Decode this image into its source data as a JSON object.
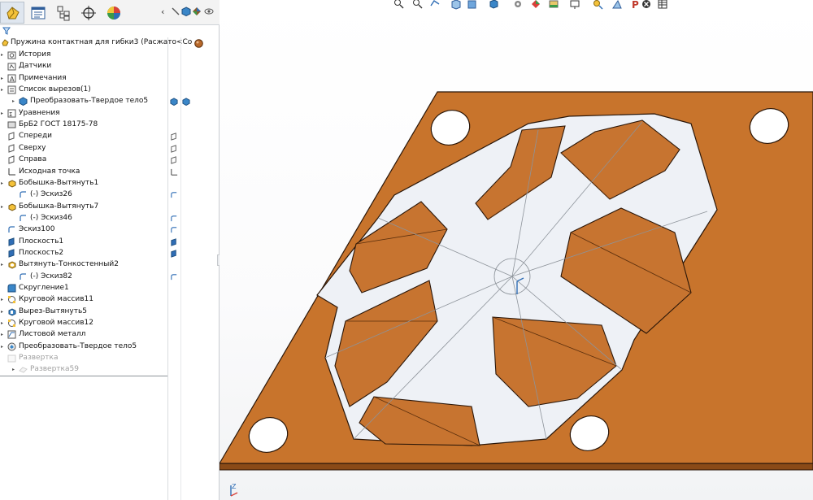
{
  "feature_tree": {
    "root_label": "Пружина контактная для гибки3  (Расжато<Сос",
    "items": [
      {
        "label": "История",
        "icon": "history-folder-icon"
      },
      {
        "label": "Датчики",
        "icon": "sensors-icon"
      },
      {
        "label": "Примечания",
        "icon": "annotations-icon"
      },
      {
        "label": "Список вырезов(1)",
        "icon": "cut-list-icon"
      },
      {
        "label": "Преобразовать-Твердое тело5",
        "icon": "solid-body-icon"
      },
      {
        "label": "Уравнения",
        "icon": "equations-icon"
      },
      {
        "label": "БрБ2 ГОСТ 18175-78",
        "icon": "material-icon"
      },
      {
        "label": "Спереди",
        "icon": "plane-icon"
      },
      {
        "label": "Сверху",
        "icon": "plane-icon"
      },
      {
        "label": "Справа",
        "icon": "plane-icon"
      },
      {
        "label": "Исходная точка",
        "icon": "origin-icon"
      },
      {
        "label": "Бобышка-Вытянуть1",
        "icon": "extrude-boss-icon"
      },
      {
        "label": "(-) Эскиз26",
        "icon": "sketch-icon"
      },
      {
        "label": "Бобышка-Вытянуть7",
        "icon": "extrude-boss-icon"
      },
      {
        "label": "(-) Эскиз46",
        "icon": "sketch-icon"
      },
      {
        "label": "Эскиз100",
        "icon": "sketch-icon"
      },
      {
        "label": "Плоскость1",
        "icon": "ref-plane-icon"
      },
      {
        "label": "Плоскость2",
        "icon": "ref-plane-icon"
      },
      {
        "label": "Вытянуть-Тонкостенный2",
        "icon": "thin-extrude-icon"
      },
      {
        "label": "(-) Эскиз82",
        "icon": "sketch-icon"
      },
      {
        "label": "Скругление1",
        "icon": "fillet-icon"
      },
      {
        "label": "Круговой массив11",
        "icon": "circular-pattern-icon"
      },
      {
        "label": "Вырез-Вытянуть5",
        "icon": "extrude-cut-icon"
      },
      {
        "label": "Круговой массив12",
        "icon": "circular-pattern-icon"
      },
      {
        "label": "Листовой металл",
        "icon": "sheet-metal-icon"
      },
      {
        "label": "Преобразовать-Твердое тело5",
        "icon": "convert-solid-icon"
      },
      {
        "label": "Развертка",
        "icon": "flat-pattern-folder-icon"
      },
      {
        "label": "Развертка59",
        "icon": "flat-pattern-icon"
      }
    ]
  },
  "triad_label": "Z",
  "colors": {
    "part_face": "#c8742c",
    "part_side": "#8a4a17",
    "part_edge": "#2a1608",
    "cavity": "#eef1f6",
    "accent": "#2f6db5"
  }
}
